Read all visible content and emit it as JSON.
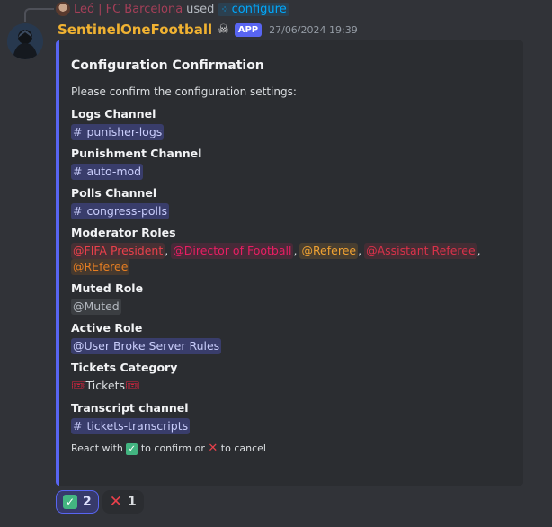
{
  "reply": {
    "user": "Leó | FC Barcelona",
    "action": "used",
    "command": "configure"
  },
  "message": {
    "author": "SentinelOneFootball",
    "badge": "APP",
    "timestamp": "27/06/2024 19:39"
  },
  "embed": {
    "accent_color": "#5865f2",
    "title": "Configuration Confirmation",
    "description": "Please confirm the configuration settings:",
    "fields": {
      "logs": {
        "name": "Logs Channel",
        "value": "punisher-logs"
      },
      "punishment": {
        "name": "Punishment Channel",
        "value": "auto-mod"
      },
      "polls": {
        "name": "Polls Channel",
        "value": "congress-polls"
      },
      "moderator_roles": {
        "name": "Moderator Roles",
        "roles": [
          {
            "label": "@FIFA President",
            "color": "#e8404b"
          },
          {
            "label": "@Director of Football",
            "color": "#e91e63"
          },
          {
            "label": "@Referee",
            "color": "#f0a232"
          },
          {
            "label": "@Assistant Referee",
            "color": "#d9324a"
          },
          {
            "label": "@REferee",
            "color": "#e67e22"
          }
        ]
      },
      "muted": {
        "name": "Muted Role",
        "value": "@Muted"
      },
      "active": {
        "name": "Active Role",
        "value": "@User Broke Server Rules"
      },
      "tickets": {
        "name": "Tickets Category",
        "value": "Tickets"
      },
      "transcript": {
        "name": "Transcript channel",
        "value": "tickets-transcripts"
      }
    },
    "footer": {
      "prefix": "React with",
      "middle": "to confirm or",
      "suffix": "to cancel"
    }
  },
  "reactions": [
    {
      "emoji": "check-mark-icon",
      "count": "2",
      "active": true
    },
    {
      "emoji": "cross-mark-icon",
      "count": "1",
      "active": false
    }
  ],
  "colors": {
    "background": "#313338",
    "embed_bg": "#2b2d31",
    "author": "#f0b232",
    "mention": "#c9cdfb"
  }
}
